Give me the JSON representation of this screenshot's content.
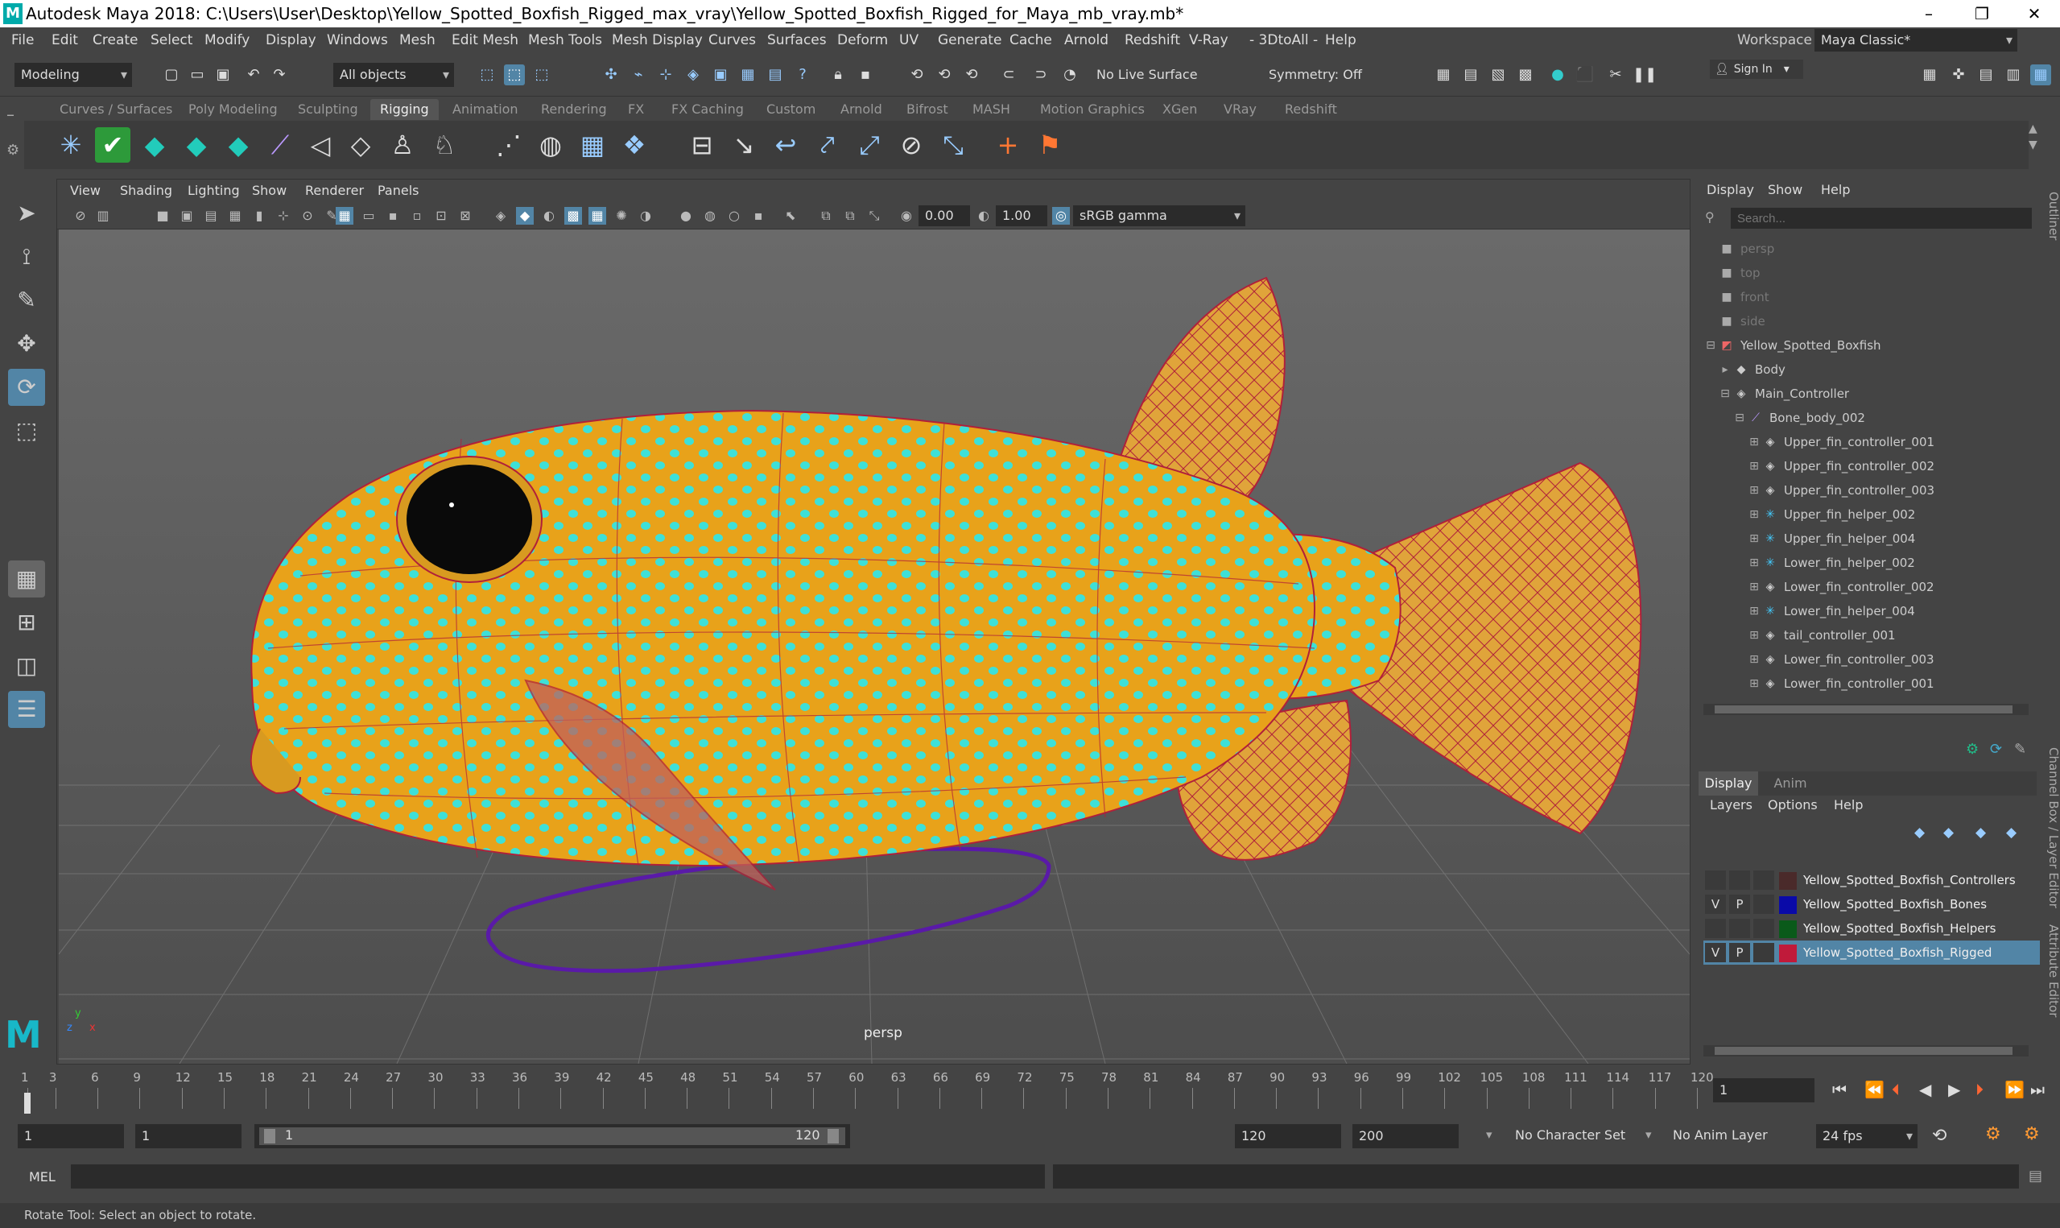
{
  "window": {
    "title": "Autodesk Maya 2018: C:\\Users\\User\\Desktop\\Yellow_Spotted_Boxfish_Rigged_max_vray\\Yellow_Spotted_Boxfish_Rigged_for_Maya_mb_vray.mb*",
    "minimize": "–",
    "maximize": "❐",
    "close": "✕"
  },
  "menu": [
    "File",
    "Edit",
    "Create",
    "Select",
    "Modify",
    "Display",
    "Windows",
    "Mesh",
    "Edit Mesh",
    "Mesh Tools",
    "Mesh Display",
    "Curves",
    "Surfaces",
    "Deform",
    "UV",
    "Generate",
    "Cache",
    "Arnold",
    "Redshift",
    "V-Ray",
    "- 3DtoAll -",
    "Help"
  ],
  "workspace": {
    "label": "Workspace :",
    "value": "Maya Classic*"
  },
  "statusline": {
    "mode": "Modeling",
    "select_set": "All objects",
    "live_surface": "No Live Surface",
    "symmetry": "Symmetry: Off",
    "sign_in": "Sign In"
  },
  "shelf_tabs": [
    "Curves / Surfaces",
    "Poly Modeling",
    "Sculpting",
    "Rigging",
    "Animation",
    "Rendering",
    "FX",
    "FX Caching",
    "Custom",
    "Arnold",
    "Bifrost",
    "MASH",
    "Motion Graphics",
    "XGen",
    "VRay",
    "Redshift"
  ],
  "active_shelf": "Rigging",
  "viewport": {
    "menus": [
      "View",
      "Shading",
      "Lighting",
      "Show",
      "Renderer",
      "Panels"
    ],
    "exposure": "0.00",
    "gamma": "1.00",
    "color_space": "sRGB gamma",
    "camera_label": "persp",
    "axis": {
      "x": "x",
      "y": "y",
      "z": "z"
    }
  },
  "outliner": {
    "menus": [
      "Display",
      "Show",
      "Help"
    ],
    "search_placeholder": "Search...",
    "items": [
      {
        "label": "persp",
        "depth": 0,
        "dim": true,
        "icon": "camera-icon"
      },
      {
        "label": "top",
        "depth": 0,
        "dim": true,
        "icon": "camera-icon"
      },
      {
        "label": "front",
        "depth": 0,
        "dim": true,
        "icon": "camera-icon"
      },
      {
        "label": "side",
        "depth": 0,
        "dim": true,
        "icon": "camera-icon"
      },
      {
        "label": "Yellow_Spotted_Boxfish",
        "depth": 0,
        "dim": false,
        "icon": "group-icon",
        "expander": "⊟"
      },
      {
        "label": "Body",
        "depth": 1,
        "dim": false,
        "icon": "mesh-icon",
        "expander": "▸"
      },
      {
        "label": "Main_Controller",
        "depth": 1,
        "dim": false,
        "icon": "transform-icon",
        "expander": "⊟"
      },
      {
        "label": "Bone_body_002",
        "depth": 2,
        "dim": false,
        "icon": "joint-icon",
        "expander": "⊟"
      },
      {
        "label": "Upper_fin_controller_001",
        "depth": 3,
        "dim": false,
        "icon": "transform-icon",
        "expander": "⊞"
      },
      {
        "label": "Upper_fin_controller_002",
        "depth": 3,
        "dim": false,
        "icon": "transform-icon",
        "expander": "⊞"
      },
      {
        "label": "Upper_fin_controller_003",
        "depth": 3,
        "dim": false,
        "icon": "transform-icon",
        "expander": "⊞"
      },
      {
        "label": "Upper_fin_helper_002",
        "depth": 3,
        "dim": false,
        "icon": "locator-icon",
        "expander": "⊞"
      },
      {
        "label": "Upper_fin_helper_004",
        "depth": 3,
        "dim": false,
        "icon": "locator-icon",
        "expander": "⊞"
      },
      {
        "label": "Lower_fin_helper_002",
        "depth": 3,
        "dim": false,
        "icon": "locator-icon",
        "expander": "⊞"
      },
      {
        "label": "Lower_fin_controller_002",
        "depth": 3,
        "dim": false,
        "icon": "transform-icon",
        "expander": "⊞"
      },
      {
        "label": "Lower_fin_helper_004",
        "depth": 3,
        "dim": false,
        "icon": "locator-icon",
        "expander": "⊞"
      },
      {
        "label": "tail_controller_001",
        "depth": 3,
        "dim": false,
        "icon": "transform-icon",
        "expander": "⊞"
      },
      {
        "label": "Lower_fin_controller_003",
        "depth": 3,
        "dim": false,
        "icon": "transform-icon",
        "expander": "⊞"
      },
      {
        "label": "Lower_fin_controller_001",
        "depth": 3,
        "dim": false,
        "icon": "transform-icon",
        "expander": "⊞"
      }
    ]
  },
  "layer_editor": {
    "tabs": [
      "Display",
      "Anim"
    ],
    "menus": [
      "Layers",
      "Options",
      "Help"
    ],
    "layers": [
      {
        "name": "Yellow_Spotted_Boxfish_Controllers",
        "v": "",
        "p": "",
        "color": "#4a2a2a",
        "selected": false
      },
      {
        "name": "Yellow_Spotted_Boxfish_Bones",
        "v": "V",
        "p": "P",
        "color": "#0a0aa8",
        "selected": false
      },
      {
        "name": "Yellow_Spotted_Boxfish_Helpers",
        "v": "",
        "p": "",
        "color": "#0a5a1a",
        "selected": false
      },
      {
        "name": "Yellow_Spotted_Boxfish_Rigged",
        "v": "V",
        "p": "P",
        "color": "#c01a3a",
        "selected": true
      }
    ]
  },
  "side_tabs": {
    "outliner": "Outliner",
    "channel_box": "Channel Box / Layer Editor",
    "attribute_editor": "Attribute Editor"
  },
  "timeline": {
    "ticks": [
      "1",
      "3",
      "6",
      "9",
      "12",
      "15",
      "18",
      "21",
      "24",
      "27",
      "30",
      "33",
      "36",
      "39",
      "42",
      "45",
      "48",
      "51",
      "54",
      "57",
      "60",
      "63",
      "66",
      "69",
      "72",
      "75",
      "78",
      "81",
      "84",
      "87",
      "90",
      "93",
      "96",
      "99",
      "102",
      "105",
      "108",
      "111",
      "114",
      "117",
      "120"
    ],
    "current_frame": "1"
  },
  "range": {
    "start": "1",
    "anim_start": "1",
    "slider_start": "1",
    "slider_end": "120",
    "end": "120",
    "anim_end": "200",
    "character_set": "No Character Set",
    "anim_layer": "No Anim Layer",
    "fps": "24 fps"
  },
  "command_line": {
    "label": "MEL"
  },
  "help_line": "Rotate Tool: Select an object to rotate.",
  "colors": {
    "accent": "#5285a6",
    "fish_body": "#e8a21a",
    "spots": "#3ee0d8",
    "wire": "#b0203a",
    "controller": "#5a1aa8"
  }
}
